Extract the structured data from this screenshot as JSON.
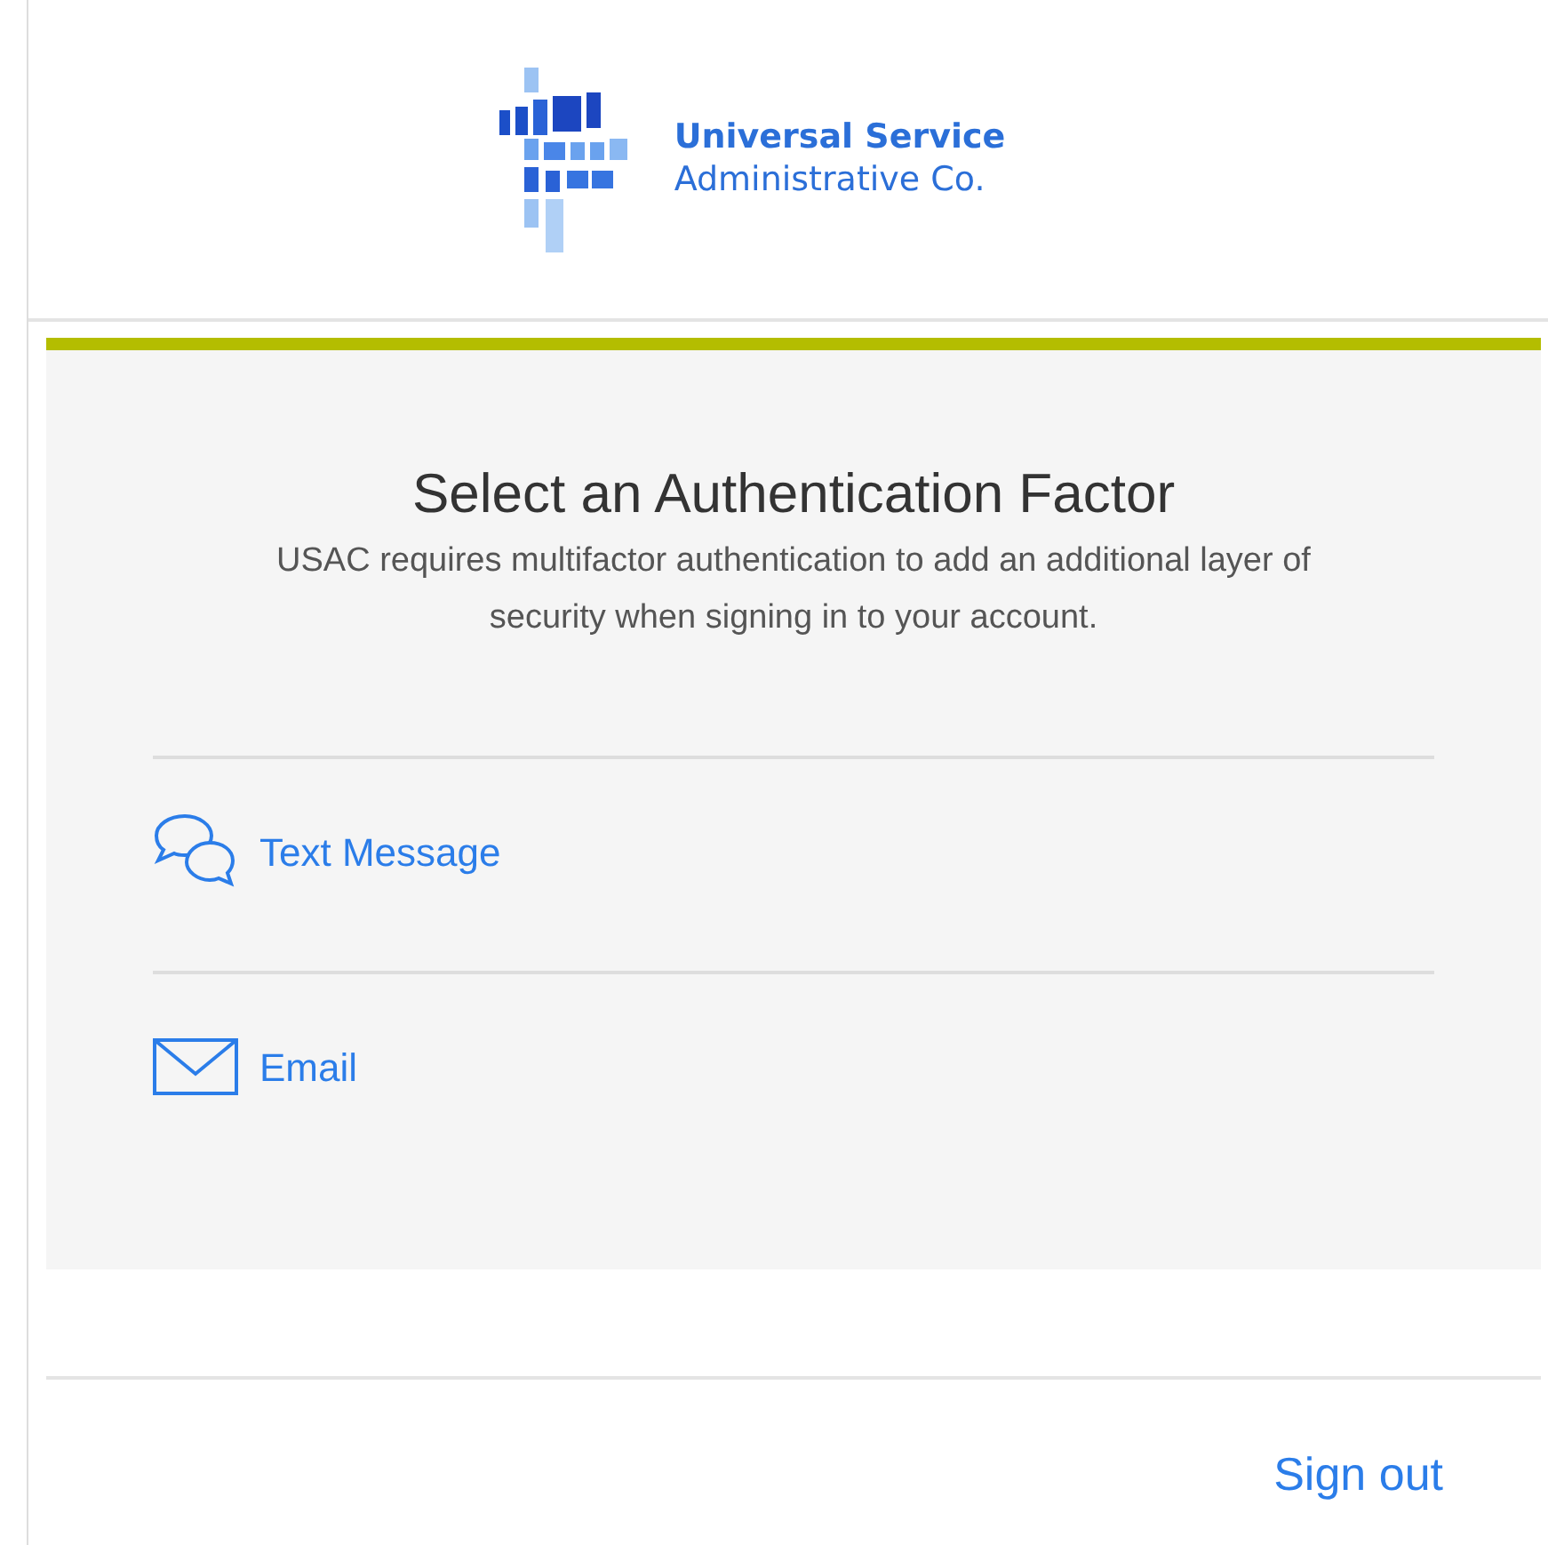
{
  "logo": {
    "line_1": "Universal Service",
    "line_2": "Administrative Co."
  },
  "title": "Select an Authentication Factor",
  "description": "USAC requires multifactor authentication to add an additional layer of security when signing in to your account.",
  "factors": [
    {
      "kind": "sms",
      "label": "Text Message"
    },
    {
      "kind": "email",
      "label": "Email"
    }
  ],
  "sign_out": "Sign out"
}
